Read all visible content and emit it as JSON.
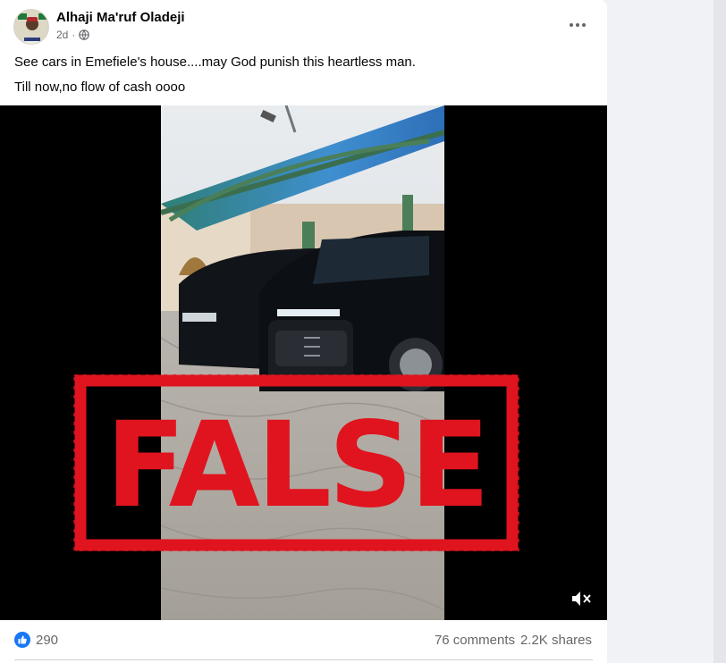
{
  "post": {
    "author": "Alhaji Ma'ruf Oladeji",
    "time": "2d",
    "privacy_icon": "globe-icon",
    "more_icon": "more-horizontal-icon",
    "caption_lines": [
      "See cars in Emefiele's house....may God punish this heartless man.",
      "Till now,no flow of cash oooo"
    ]
  },
  "video": {
    "overlay_stamp": "FALSE",
    "stamp_color": "#e0141e",
    "mute_icon": "volume-muted-icon"
  },
  "stats": {
    "like_icon": "like-thumb-icon",
    "like_color": "#1877f2",
    "likes": "290",
    "comments": "76 comments",
    "shares": "2.2K shares"
  }
}
